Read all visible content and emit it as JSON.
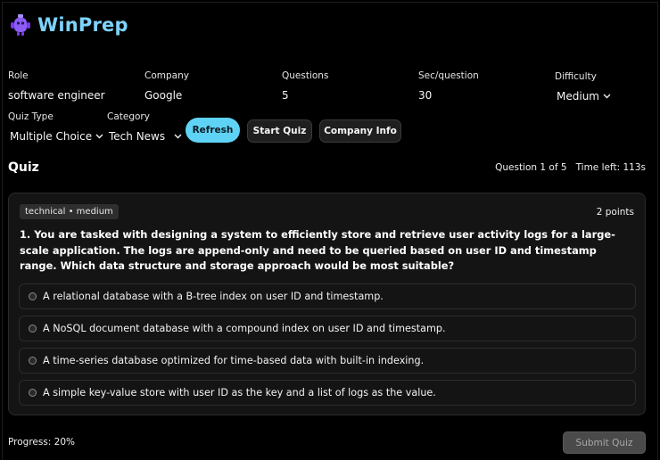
{
  "app": {
    "title": "WinPrep",
    "logo_icon": "robot-icon"
  },
  "form": {
    "role": {
      "label": "Role",
      "value": "software engineer"
    },
    "company": {
      "label": "Company",
      "value": "Google"
    },
    "questions": {
      "label": "Questions",
      "value": "5"
    },
    "sec_per_question": {
      "label": "Sec/question",
      "value": "30"
    },
    "difficulty": {
      "label": "Difficulty",
      "value": "Medium"
    },
    "quiz_type": {
      "label": "Quiz Type",
      "value": "Multiple Choice"
    },
    "category": {
      "label": "Category",
      "value": "Tech News"
    }
  },
  "buttons": {
    "refresh": "Refresh",
    "start_quiz": "Start Quiz",
    "company_info": "Company Info",
    "submit_quiz": "Submit Quiz"
  },
  "quiz": {
    "title": "Quiz",
    "question_counter": "Question 1 of 5",
    "time_left": "Time left: 113s",
    "tag": "technical • medium",
    "points": "2 points",
    "question": "1. You are tasked with designing a system to efficiently store and retrieve user activity logs for a large-scale application. The logs are append-only and need to be queried based on user ID and timestamp range. Which data structure and storage approach would be most suitable?",
    "options": [
      "A relational database with a B-tree index on user ID and timestamp.",
      "A NoSQL document database with a compound index on user ID and timestamp.",
      "A time-series database optimized for time-based data with built-in indexing.",
      "A simple key-value store with user ID as the key and a list of logs as the value."
    ]
  },
  "progress": {
    "label": "Progress: 20%",
    "value": 0.2
  },
  "colors": {
    "accent": "#5fd3f5",
    "title": "#7dd3fc",
    "background": "#000000",
    "card": "#141414"
  }
}
